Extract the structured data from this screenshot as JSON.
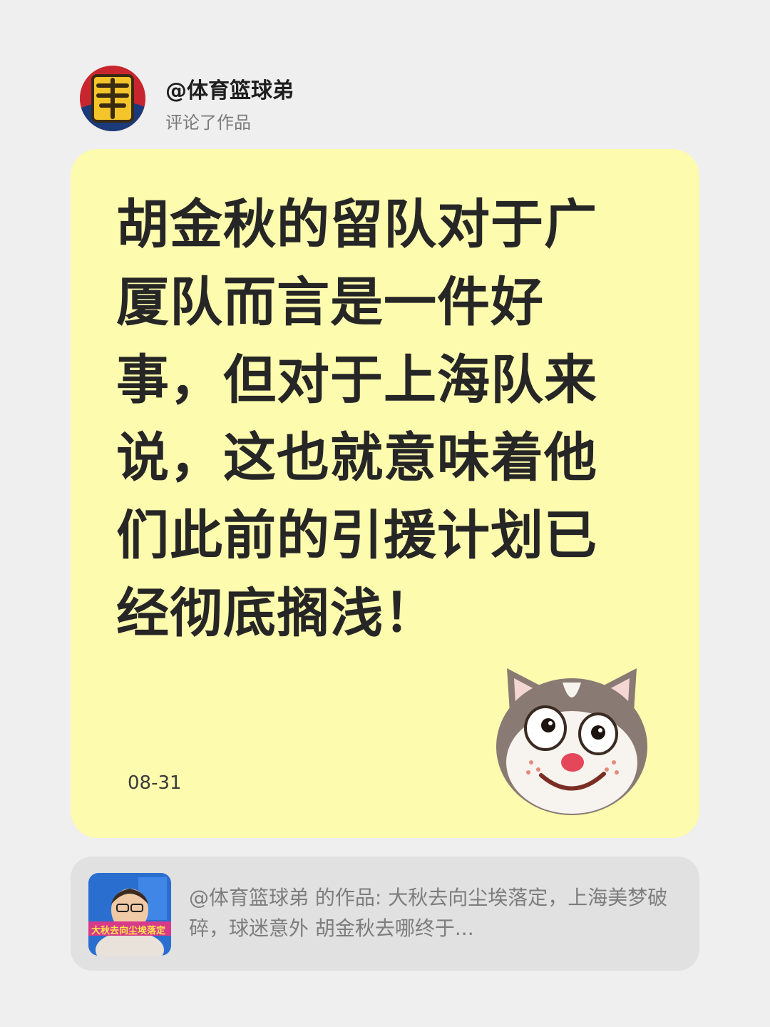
{
  "author": {
    "name": "@体育篮球弟",
    "action": "评论了作品"
  },
  "comment": {
    "text": "胡金秋的留队对于广厦队而言是一件好事，但对于上海队来说，这也就意味着他们此前的引援计划已经彻底搁浅！",
    "date": "08-31"
  },
  "work": {
    "description": "@体育篮球弟 的作品: 大秋去向尘埃落定，上海美梦破碎，球迷意外 胡金秋去哪终于...",
    "thumbnail_caption": "大秋去向尘埃落定"
  },
  "icons": {
    "avatar": "basketball-logo-icon",
    "sticker": "husky-dog-emoji-icon"
  },
  "colors": {
    "background": "#efefef",
    "card": "#fdfbae",
    "work_card": "#e1e1e1",
    "text_dark": "#262626",
    "text_muted": "#7a7a7a"
  }
}
